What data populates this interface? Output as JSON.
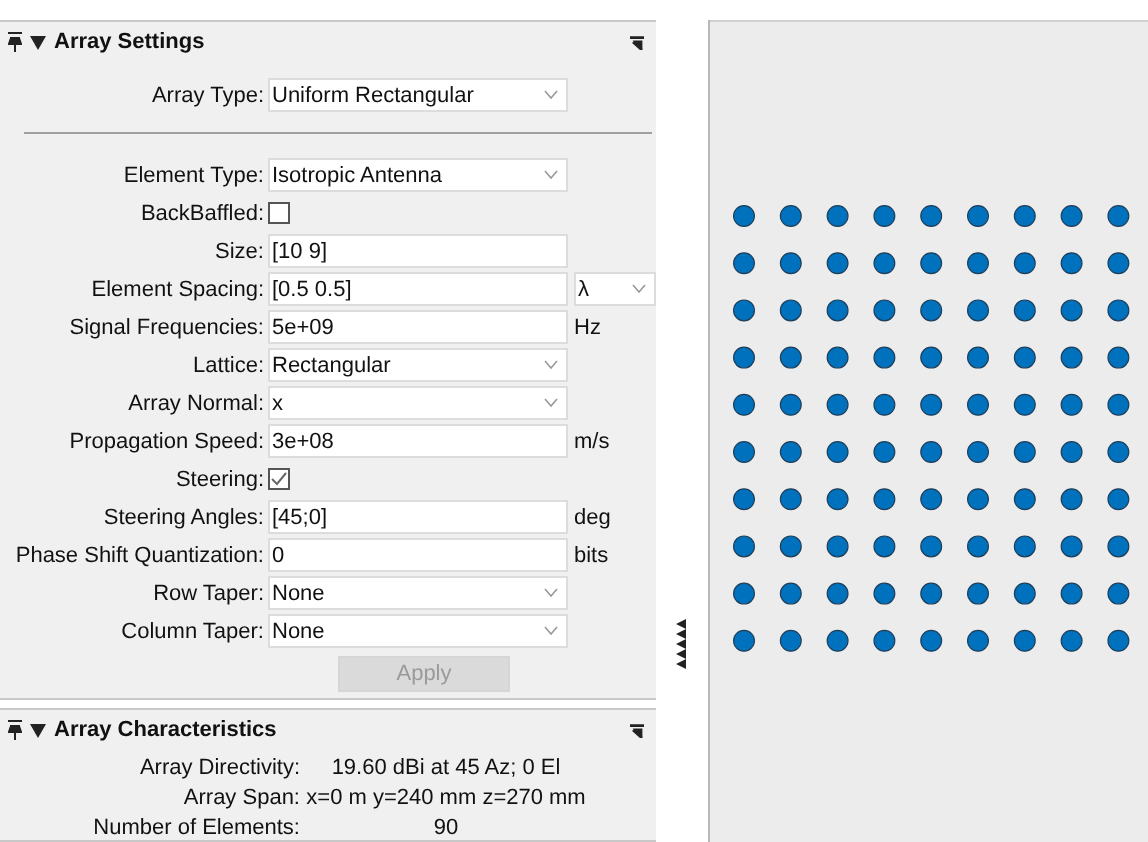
{
  "settings_panel": {
    "title": "Array Settings",
    "expanded": true,
    "array_type": {
      "label": "Array Type:",
      "value": "Uniform Rectangular"
    },
    "fields": [
      {
        "kind": "dropdown",
        "label": "Element Type:",
        "value": "Isotropic Antenna"
      },
      {
        "kind": "checkbox",
        "label": "BackBaffled:",
        "checked": false
      },
      {
        "kind": "text",
        "label": "Size:",
        "value": "[10 9]"
      },
      {
        "kind": "text",
        "label": "Element Spacing:",
        "value": "[0.5 0.5]",
        "unit_dropdown": "λ"
      },
      {
        "kind": "text",
        "label": "Signal Frequencies:",
        "value": "5e+09",
        "unit": "Hz"
      },
      {
        "kind": "dropdown",
        "label": "Lattice:",
        "value": "Rectangular"
      },
      {
        "kind": "dropdown",
        "label": "Array Normal:",
        "value": "x"
      },
      {
        "kind": "text",
        "label": "Propagation Speed:",
        "value": "3e+08",
        "unit": "m/s"
      },
      {
        "kind": "checkbox",
        "label": "Steering:",
        "checked": true
      },
      {
        "kind": "text",
        "label": "Steering Angles:",
        "value": "[45;0]",
        "unit": "deg"
      },
      {
        "kind": "text",
        "label": "Phase Shift Quantization:",
        "value": "0",
        "unit": "bits"
      },
      {
        "kind": "dropdown",
        "label": "Row Taper:",
        "value": "None"
      },
      {
        "kind": "dropdown",
        "label": "Column Taper:",
        "value": "None"
      }
    ],
    "apply_button": {
      "label": "Apply",
      "disabled": true
    }
  },
  "characteristics_panel": {
    "title": "Array Characteristics",
    "expanded": true,
    "rows": [
      {
        "label": "Array Directivity:",
        "value": "19.60 dBi at 45 Az; 0 El"
      },
      {
        "label": "Array Span:",
        "value": "x=0 m y=240 mm z=270 mm"
      },
      {
        "label": "Number of Elements:",
        "value": "90"
      }
    ]
  }
}
